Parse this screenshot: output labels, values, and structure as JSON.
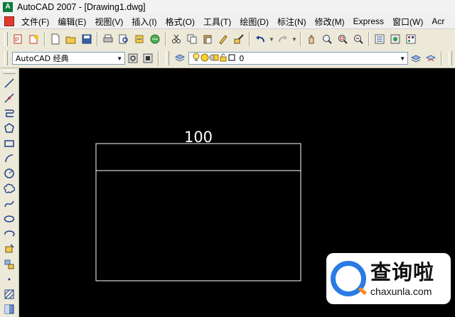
{
  "window": {
    "title": "AutoCAD 2007 - [Drawing1.dwg]",
    "icon": "autocad-app-icon"
  },
  "menu": {
    "items": [
      "文件(F)",
      "编辑(E)",
      "视图(V)",
      "插入(I)",
      "格式(O)",
      "工具(T)",
      "绘图(D)",
      "标注(N)",
      "修改(M)",
      "Express",
      "窗口(W)",
      "Acr"
    ]
  },
  "standard_toolbar": {
    "icons": [
      "sheet-set-icon",
      "markup-icon",
      "new-icon",
      "open-icon",
      "save-icon",
      "print-icon",
      "plot-preview-icon",
      "publish-icon",
      "3d-dwf-icon",
      "cut-icon",
      "copy-icon",
      "paste-icon",
      "match-properties-icon",
      "block-editor-icon",
      "undo-icon",
      "redo-icon",
      "pan-icon",
      "zoom-realtime-icon",
      "zoom-window-icon",
      "zoom-previous-icon",
      "properties-icon",
      "design-center-icon",
      "tool-palettes-icon"
    ]
  },
  "workspace_toolbar": {
    "workspace_value": "AutoCAD 经典",
    "layer_value": "0"
  },
  "draw_toolbar": {
    "icons": [
      "line-icon",
      "construction-line-icon",
      "polyline-icon",
      "polygon-icon",
      "rectangle-icon",
      "arc-icon",
      "circle-icon",
      "revision-cloud-icon",
      "spline-icon",
      "ellipse-icon",
      "ellipse-arc-icon",
      "insert-block-icon",
      "make-block-icon",
      "point-icon",
      "hatch-icon",
      "gradient-icon"
    ]
  },
  "drawing": {
    "dimension_text": "100",
    "background": "#000000",
    "line_color": "#ffffff"
  },
  "watermark": {
    "name": "查询啦",
    "url": "chaxunla.com",
    "accent": "#2a7be4"
  }
}
